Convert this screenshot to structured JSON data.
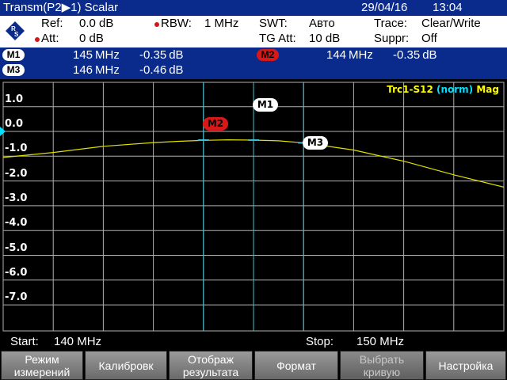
{
  "titlebar": {
    "mode": "Transm(P2▶1) Scalar",
    "date": "29/04/16",
    "time": "13:04"
  },
  "settings": {
    "ref_label": "Ref:",
    "ref_value": "0.0 dB",
    "att_label": "Att:",
    "att_value": "0 dB",
    "rbw_label": "RBW:",
    "rbw_value": "1 MHz",
    "swt_label": "SWT:",
    "swt_value": "Авто",
    "tgatt_label": "TG Att:",
    "tgatt_value": "10 dB",
    "trace_label": "Trace:",
    "trace_value": "Clear/Write",
    "suppr_label": "Suppr:",
    "suppr_value": "Off"
  },
  "markers": [
    {
      "name": "M1",
      "freq": "145 MHz",
      "level": "-0.35 dB",
      "color": "#ffffff"
    },
    {
      "name": "M2",
      "freq": "144 MHz",
      "level": "-0.35 dB",
      "color": "#d81818"
    },
    {
      "name": "M3",
      "freq": "146 MHz",
      "level": "-0.46 dB",
      "color": "#ffffff"
    }
  ],
  "graph": {
    "trace_label_yellow": "Trc1-S12",
    "trace_label_cyan": "(norm)",
    "trace_label_mag": "Mag",
    "ref_marker": "0.0",
    "y_labels": [
      "1.0",
      "0.0",
      "-1.0",
      "-2.0",
      "-3.0",
      "-4.0",
      "-5.0",
      "-6.0",
      "-7.0"
    ],
    "trace_color": "#e0e000",
    "marker_line_color": "#40c0d0"
  },
  "chart_data": {
    "type": "line",
    "xlim": [
      140,
      150
    ],
    "ylim": [
      -8,
      1.5
    ],
    "x": [
      140,
      141,
      142,
      143,
      143.5,
      144,
      144.5,
      145,
      145.5,
      146,
      147,
      148,
      149,
      150
    ],
    "series": [
      {
        "values": [
          -1.05,
          -0.85,
          -0.6,
          -0.45,
          -0.4,
          -0.36,
          -0.34,
          -0.35,
          -0.38,
          -0.46,
          -0.75,
          -1.2,
          -1.75,
          -2.25
        ]
      }
    ],
    "marker_x": [
      145,
      144,
      146
    ],
    "marker_y": [
      -0.35,
      -0.35,
      -0.46
    ],
    "ylabel_ticks": [
      1.0,
      0.0,
      -1.0,
      -2.0,
      -3.0,
      -4.0,
      -5.0,
      -6.0,
      -7.0
    ]
  },
  "freqbar": {
    "start_label": "Start:",
    "start_value": "140 MHz",
    "stop_label": "Stop:",
    "stop_value": "150 MHz"
  },
  "softkeys": [
    {
      "label": "Режим\nизмерений",
      "enabled": true
    },
    {
      "label": "Калибровк",
      "enabled": true
    },
    {
      "label": "Отображ\nрезультата",
      "enabled": true
    },
    {
      "label": "Формат",
      "enabled": true
    },
    {
      "label": "Выбрать\nкривую",
      "enabled": false
    },
    {
      "label": "Настройка",
      "enabled": true
    }
  ]
}
